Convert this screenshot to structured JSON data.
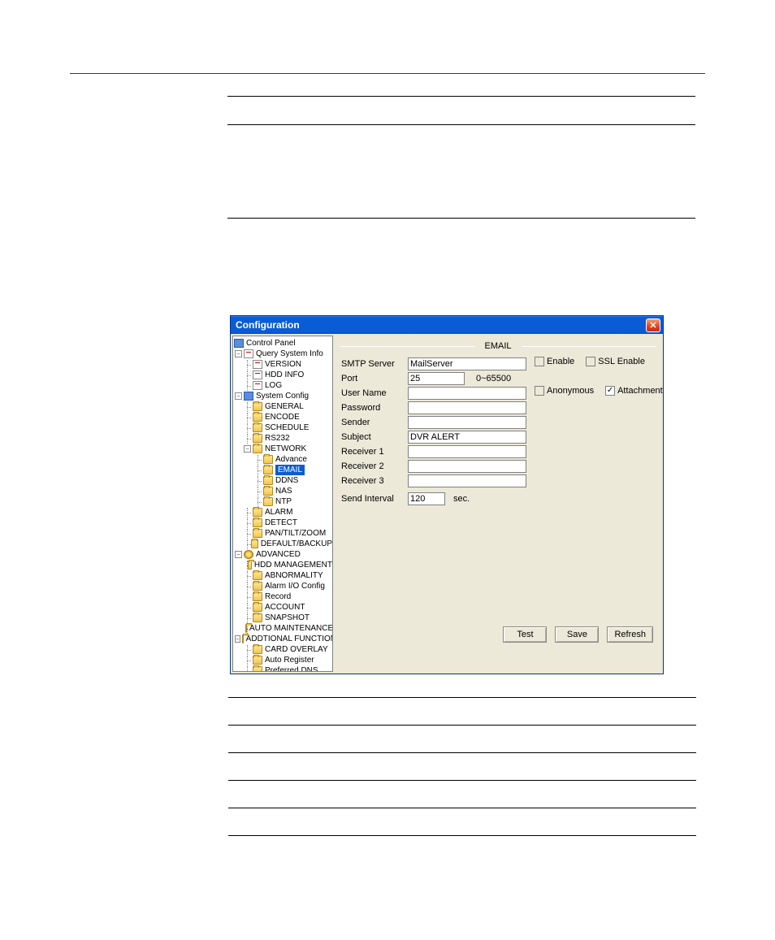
{
  "dialog": {
    "title": "Configuration",
    "close": "✕",
    "section": "EMAIL",
    "buttons": {
      "test": "Test",
      "save": "Save",
      "refresh": "Refresh"
    },
    "checkboxes": {
      "enable": {
        "label": "Enable",
        "checked": false,
        "disabled": true
      },
      "ssl": {
        "label": "SSL Enable",
        "checked": false,
        "disabled": true
      },
      "anon": {
        "label": "Anonymous",
        "checked": false,
        "disabled": true
      },
      "attach": {
        "label": "Attachment",
        "checked": true,
        "disabled": false
      }
    },
    "fields": {
      "smtp": {
        "label": "SMTP Server",
        "value": "MailServer"
      },
      "port": {
        "label": "Port",
        "value": "25",
        "hint": "0~65500"
      },
      "user": {
        "label": "User Name",
        "value": ""
      },
      "pwd": {
        "label": "Password",
        "value": ""
      },
      "sender": {
        "label": "Sender",
        "value": ""
      },
      "subject": {
        "label": "Subject",
        "value": "DVR ALERT"
      },
      "recv1": {
        "label": "Receiver 1",
        "value": ""
      },
      "recv2": {
        "label": "Receiver 2",
        "value": ""
      },
      "recv3": {
        "label": "Receiver 3",
        "value": ""
      },
      "interval": {
        "label": "Send Interval",
        "value": "120",
        "unit": "sec."
      }
    }
  },
  "tree": {
    "root": "Control Panel",
    "query": {
      "label": "Query System Info",
      "items": [
        "VERSION",
        "HDD INFO",
        "LOG"
      ]
    },
    "system": {
      "label": "System Config",
      "items": [
        "GENERAL",
        "ENCODE",
        "SCHEDULE",
        "RS232"
      ],
      "network": {
        "label": "NETWORK",
        "items": [
          "Advance",
          "EMAIL",
          "DDNS",
          "NAS",
          "NTP"
        ]
      },
      "items2": [
        "ALARM",
        "DETECT",
        "PAN/TILT/ZOOM",
        "DEFAULT/BACKUP"
      ]
    },
    "advanced": {
      "label": "ADVANCED",
      "items": [
        "HDD MANAGEMENT",
        "ABNORMALITY",
        "Alarm I/O Config",
        "Record",
        "ACCOUNT",
        "SNAPSHOT",
        "AUTO MAINTENANCE"
      ]
    },
    "additional": {
      "label": "ADDTIONAL FUNCTION",
      "items": [
        "CARD OVERLAY",
        "Auto Register",
        "Preferred DNS"
      ]
    }
  }
}
